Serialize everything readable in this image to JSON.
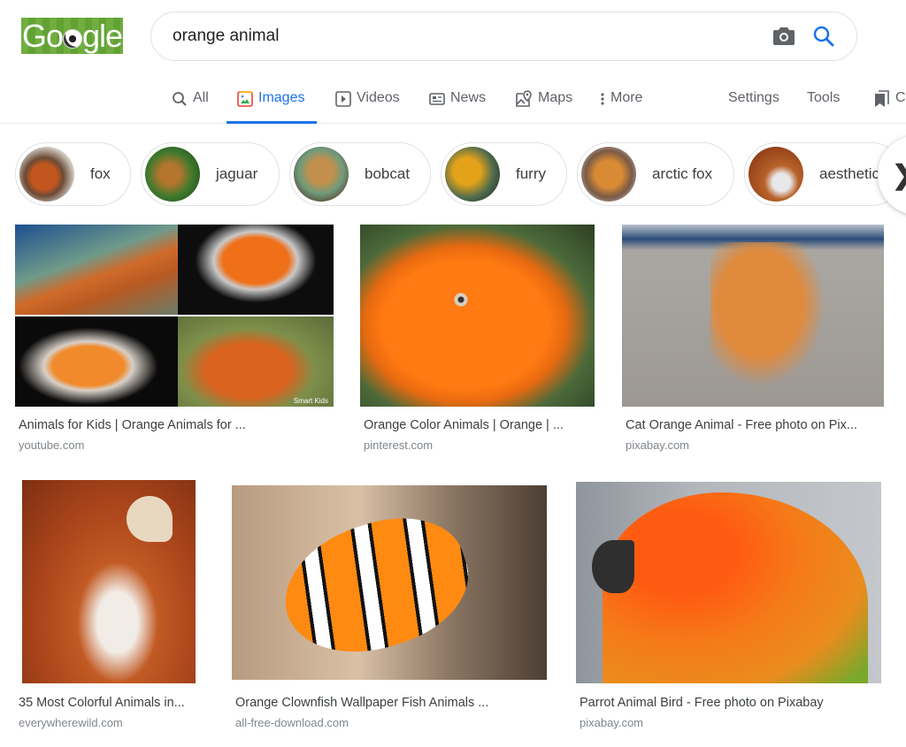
{
  "header": {
    "logo_text_pre": "Go",
    "logo_text_post": "gle",
    "search_value": "orange animal",
    "camera_icon": "camera-icon",
    "search_icon": "search-icon"
  },
  "nav": {
    "tabs": [
      {
        "label": "All",
        "icon": "search-icon",
        "active": false
      },
      {
        "label": "Images",
        "icon": "image-icon",
        "active": true
      },
      {
        "label": "Videos",
        "icon": "play-icon",
        "active": false
      },
      {
        "label": "News",
        "icon": "news-icon",
        "active": false
      },
      {
        "label": "Maps",
        "icon": "map-pin-icon",
        "active": false
      },
      {
        "label": "More",
        "icon": "more-vert-icon",
        "active": false
      }
    ],
    "settings": "Settings",
    "tools": "Tools",
    "collections_partial": "C"
  },
  "chips": [
    {
      "label": "fox"
    },
    {
      "label": "jaguar"
    },
    {
      "label": "bobcat"
    },
    {
      "label": "furry"
    },
    {
      "label": "arctic fox"
    },
    {
      "label": "aesthetic"
    }
  ],
  "results": [
    {
      "title": "Animals for Kids | Orange Animals for ...",
      "source": "youtube.com",
      "watermark": "Smart Kids"
    },
    {
      "title": "Orange Color Animals | Orange | ...",
      "source": "pinterest.com"
    },
    {
      "title": "Cat Orange Animal - Free photo on Pix...",
      "source": "pixabay.com"
    },
    {
      "title": "35 Most Colorful Animals in...",
      "source": "everywherewild.com"
    },
    {
      "title": "Orange Clownfish Wallpaper Fish Animals ...",
      "source": "all-free-download.com"
    },
    {
      "title": "Parrot Animal Bird - Free photo on Pixabay",
      "source": "pixabay.com"
    }
  ],
  "colors": {
    "accent": "#1a73e8",
    "text_primary": "#202124",
    "text_secondary": "#5f6368",
    "source_gray": "#80868b",
    "logo_green": "#6fae3f"
  }
}
